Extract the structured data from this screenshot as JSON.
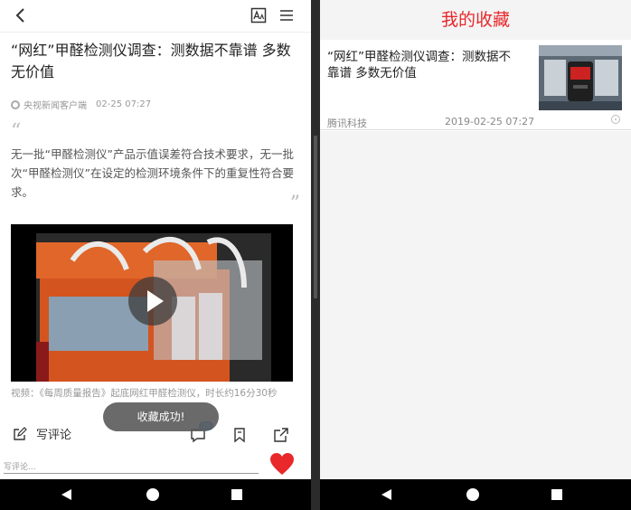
{
  "article": {
    "title": "“网红”甲醛检测仪调查：测数据不靠谱 多数无价值",
    "source": "央视新闻客户端",
    "time": "02-25 07:27",
    "quote": "无一批“甲醛检测仪”产品示值误差符合技术要求，无一批次“甲醛检测仪”在设定的检测环境条件下的重复性符合要求。",
    "video_caption": "视频：《每周质量报告》起底网红甲醛检测仪，时长约16分30秒",
    "toast": "收藏成功!",
    "comment_label": "写评论",
    "comment_count": "15",
    "comment_placeholder": "写评论...",
    "icons": {
      "back": "back-arrow-icon",
      "font": "font-size-icon",
      "menu": "menu-icon",
      "edit": "edit-icon",
      "comments": "comments-icon",
      "bookmark": "bookmark-icon",
      "share": "share-icon",
      "heart": "heart-icon"
    },
    "heart_color": "#e8282b"
  },
  "favorites": {
    "title": "我的收藏",
    "title_color": "#e8282b",
    "items": [
      {
        "title": "“网红”甲醛检测仪调查：测数据不靠谱 多数无价值",
        "source": "腾讯科技",
        "time": "2019-02-25 07:27"
      }
    ]
  }
}
